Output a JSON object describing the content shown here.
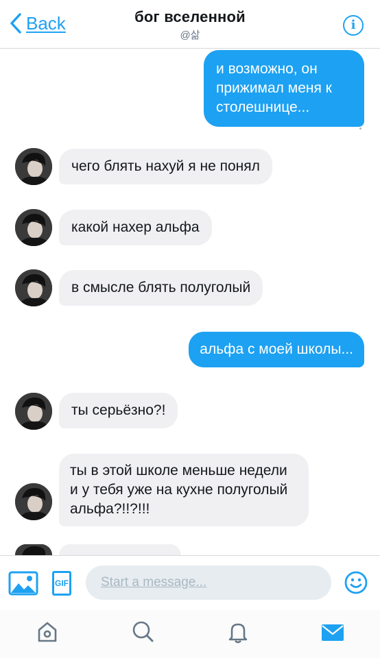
{
  "header": {
    "back_label": "Back",
    "title": "бог вселенной",
    "handle": "@삶",
    "info_label": "i"
  },
  "messages": [
    {
      "side": "out",
      "text": "и возможно, он прижимал меня к столешнице..."
    },
    {
      "side": "in",
      "text": "чего блять нахуй я не понял"
    },
    {
      "side": "in",
      "text": "какой нахер альфа"
    },
    {
      "side": "in",
      "text": "в смысле блять полуголый"
    },
    {
      "side": "out",
      "text": "альфа с моей школы..."
    },
    {
      "side": "in",
      "text": "ты серьёзно?!"
    },
    {
      "side": "in",
      "text": "ты в этой школе меньше недели и у тебя уже на кухне полуголый альфа?!!?!!!"
    }
  ],
  "composer": {
    "placeholder": "Start a message...",
    "gif_label": "GIF",
    "icons": [
      "image-icon",
      "gif-icon",
      "emoji-icon"
    ]
  },
  "tabbar": {
    "items": [
      "home-icon",
      "search-icon",
      "notifications-icon",
      "messages-icon"
    ],
    "active": "messages-icon"
  },
  "colors": {
    "accent": "#1da1f2",
    "incoming_bubble": "#f0f0f3",
    "text": "#14171a",
    "muted": "#657786"
  }
}
